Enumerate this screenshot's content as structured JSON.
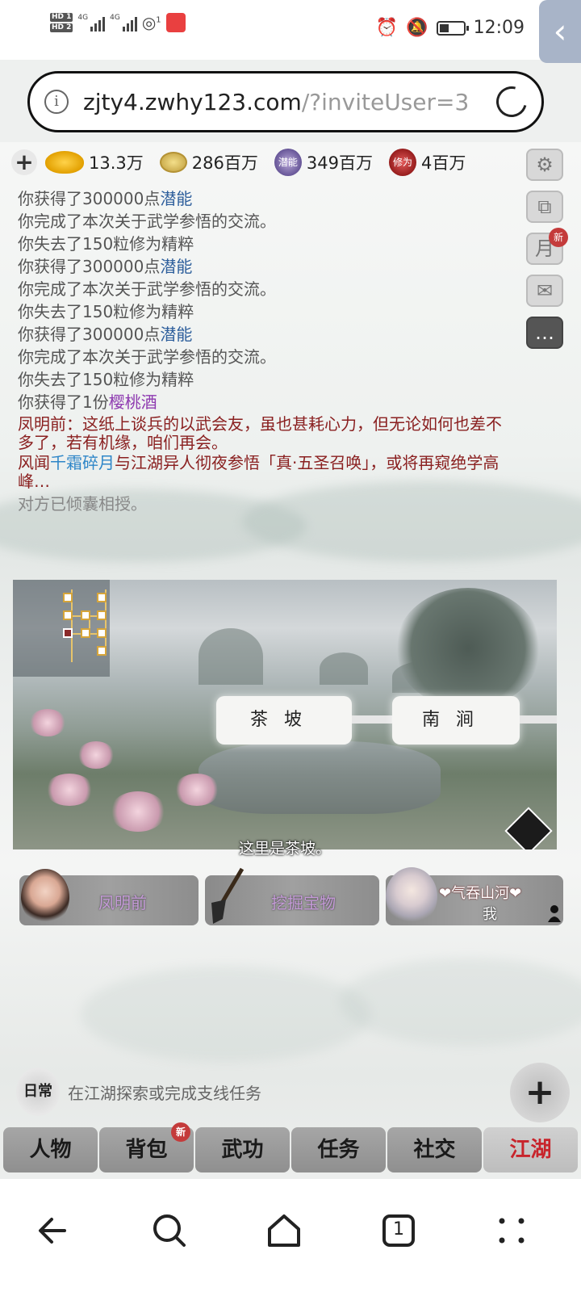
{
  "status_bar": {
    "hd1": "HD 1",
    "hd2": "HD 2",
    "net1": "4G",
    "net2": "4G",
    "hotspot": "1",
    "time": "12:09"
  },
  "browser": {
    "url_host": "zjty4.zwhy123.com",
    "url_path": "/?inviteUser=3",
    "tab_count": "1"
  },
  "resources": {
    "gold": "13.3万",
    "coin": "286百万",
    "qianneng_icon_text": "潜能",
    "qianneng": "349百万",
    "xiuwei_icon_text": "修为",
    "xiuwei": "4百万"
  },
  "right_menu": {
    "month_icon_text": "月",
    "month_badge": "新"
  },
  "log": {
    "l1_pre": "你获得了300000点",
    "l1_hl": "潜能",
    "l2": "你完成了本次关于武学参悟的交流。",
    "l3": "你失去了150粒修为精粹",
    "l4_pre": "你获得了300000点",
    "l4_hl": "潜能",
    "l5": "你完成了本次关于武学参悟的交流。",
    "l6": "你失去了150粒修为精粹",
    "l7_pre": "你获得了300000点",
    "l7_hl": "潜能",
    "l8": "你完成了本次关于武学参悟的交流。",
    "l9": "你失去了150粒修为精粹",
    "l10_pre": "你获得了1份",
    "l10_hl": "樱桃酒",
    "l11": "凤明前：这纸上谈兵的以武会友，虽也甚耗心力，但无论如何也差不多了，若有机缘，咱们再会。",
    "l12_pre": "风闻",
    "l12_hl": "千霜碎月",
    "l12_post": "与江湖异人彻夜参悟「真·五圣召唤」，或将再窥绝学高峰…",
    "l13": "对方已倾囊相授。"
  },
  "scene": {
    "location_current": "茶坡",
    "location_next": "南涧",
    "caption": "这里是茶坡。"
  },
  "npcs": {
    "npc1": "凤明前",
    "npc2": "挖掘宝物",
    "player_name": "❤气吞山河❤",
    "player_me": "我"
  },
  "daily": {
    "badge": "日常",
    "text": "在江湖探索或完成支线任务",
    "plus": "+"
  },
  "tabs": [
    {
      "label": "人物"
    },
    {
      "label": "背包",
      "badge": "新"
    },
    {
      "label": "武功"
    },
    {
      "label": "任务"
    },
    {
      "label": "社交"
    },
    {
      "label": "江湖"
    }
  ],
  "colors": {
    "accent_red": "#c8242b",
    "link_blue": "#2e5f9c",
    "item_purple": "#8e3ab0",
    "dialog_red": "#8a2020"
  }
}
